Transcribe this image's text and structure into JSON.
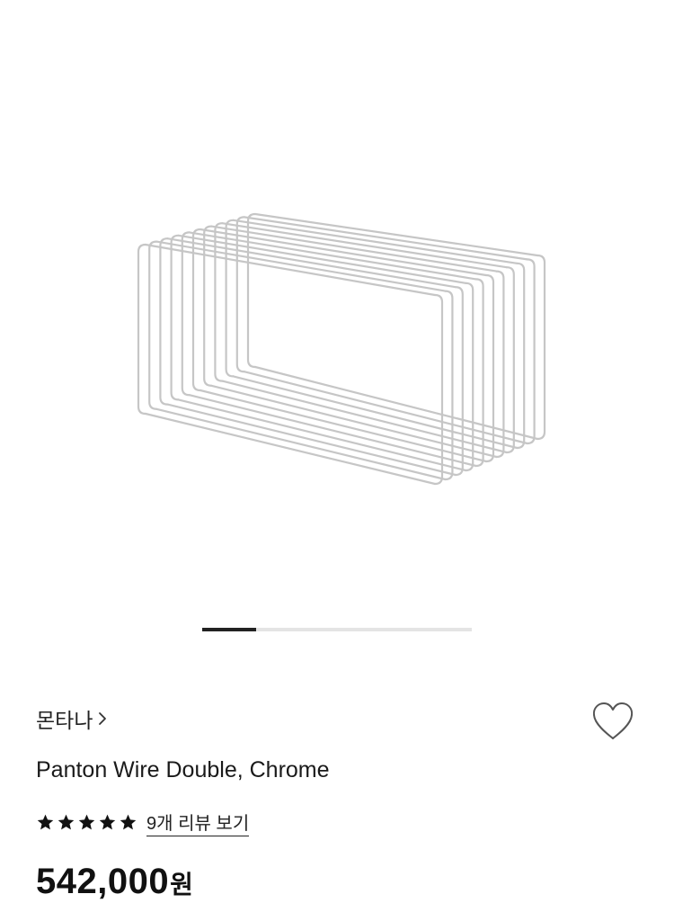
{
  "gallery": {
    "image_alt": "Panton Wire Double, Chrome",
    "current_slide": 1,
    "progress_fraction": 0.2
  },
  "brand": {
    "name": "몬타나"
  },
  "product": {
    "title": "Panton Wire Double, Chrome"
  },
  "rating": {
    "stars": 5,
    "reviews_label": "9개 리뷰 보기"
  },
  "price": {
    "amount": "542,000",
    "currency": "원"
  },
  "icons": {
    "brand_chevron": "chevron-right-icon",
    "wishlist": "heart-outline-icon",
    "rating_star": "star-icon"
  },
  "colors": {
    "text": "#111111",
    "pager_active": "#222222",
    "pager_track": "#e4e4e4",
    "heart_outline": "#555555",
    "wire_chrome": "#c8c8c8"
  }
}
